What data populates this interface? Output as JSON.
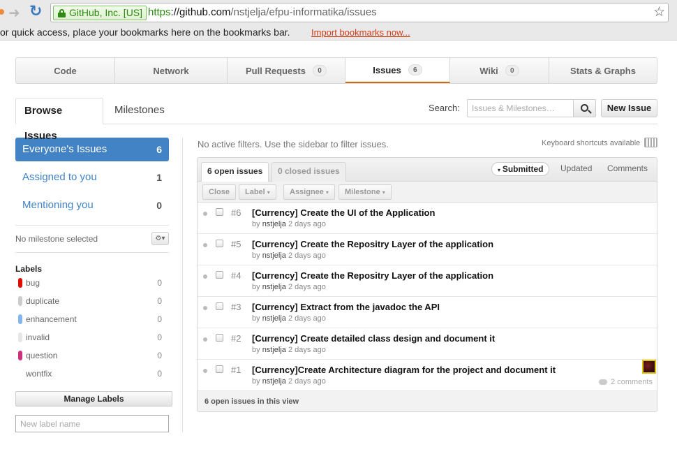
{
  "browser": {
    "identity_badge": "GitHub, Inc. [US]",
    "url_scheme": "https",
    "url_host": "://github.com",
    "url_path": "/nstjelja/efpu-informatika/issues",
    "bookmarks_prompt": "or quick access, place your bookmarks here on the bookmarks bar.",
    "import_link": "Import bookmarks now..."
  },
  "repo_tabs": [
    {
      "label": "Code"
    },
    {
      "label": "Network"
    },
    {
      "label": "Pull Requests",
      "count": "0"
    },
    {
      "label": "Issues",
      "count": "6"
    },
    {
      "label": "Wiki",
      "count": "0"
    },
    {
      "label": "Stats & Graphs"
    }
  ],
  "subnav": {
    "browse": "Browse Issues",
    "milestones": "Milestones",
    "search_label": "Search:",
    "search_placeholder": "Issues & Milestones…",
    "new_issue": "New Issue"
  },
  "sidebar": {
    "filters": [
      {
        "label": "Everyone's Issues",
        "count": "6"
      },
      {
        "label": "Assigned to you",
        "count": "1"
      },
      {
        "label": "Mentioning you",
        "count": "0"
      }
    ],
    "milestone": "No milestone selected",
    "labels_heading": "Labels",
    "labels": [
      {
        "name": "bug",
        "count": "0",
        "color": "#e10c02"
      },
      {
        "name": "duplicate",
        "count": "0",
        "color": "#cccccc"
      },
      {
        "name": "enhancement",
        "count": "0",
        "color": "#84b6eb"
      },
      {
        "name": "invalid",
        "count": "0",
        "color": "#e6e6e6"
      },
      {
        "name": "question",
        "count": "0",
        "color": "#cc317c"
      },
      {
        "name": "wontfix",
        "count": "0",
        "color": "#ffffff"
      }
    ],
    "manage_labels": "Manage Labels",
    "new_label_placeholder": "New label name"
  },
  "main": {
    "no_filters": "No active filters. Use the sidebar to filter issues.",
    "keyboard_shortcuts": "Keyboard shortcuts available",
    "open_tab": "6 open issues",
    "closed_tab": "0 closed issues",
    "sort_submitted": "Submitted",
    "sort_updated": "Updated",
    "sort_comments": "Comments",
    "actions": {
      "close": "Close",
      "label": "Label",
      "assignee": "Assignee",
      "milestone": "Milestone"
    },
    "issues": [
      {
        "number": "#6",
        "title": "[Currency] Create the UI of the Application",
        "by": "by",
        "author": "nstjelja",
        "age": "2 days ago"
      },
      {
        "number": "#5",
        "title": "[Currency] Create the Repositry Layer of the application",
        "by": "by",
        "author": "nstjelja",
        "age": "2 days ago"
      },
      {
        "number": "#4",
        "title": "[Currency] Create the Repositry Layer of the application",
        "by": "by",
        "author": "nstjelja",
        "age": "2 days ago"
      },
      {
        "number": "#3",
        "title": "[Currency] Extract from the javadoc the API",
        "by": "by",
        "author": "nstjelja",
        "age": "2 days ago"
      },
      {
        "number": "#2",
        "title": "[Currency] Create detailed class design and document it",
        "by": "by",
        "author": "nstjelja",
        "age": "2 days ago"
      },
      {
        "number": "#1",
        "title": "[Currency]Create Architecture diagram for the project and document it",
        "by": "by",
        "author": "nstjelja",
        "age": "2 days ago",
        "comments": "2 comments"
      }
    ],
    "footer": "6 open issues in this view"
  }
}
